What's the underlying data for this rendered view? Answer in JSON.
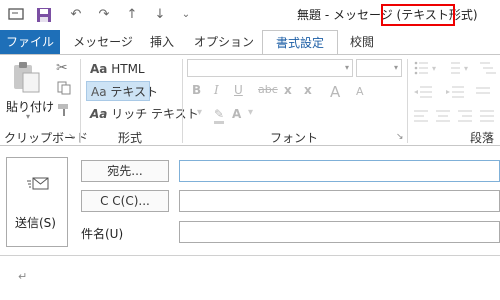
{
  "window": {
    "title": "無題 - メッセージ (テキスト形式)"
  },
  "qat": {
    "icons": [
      "minimize-box-icon",
      "save-icon",
      "undo-icon",
      "redo-icon",
      "up-arrow-icon",
      "down-arrow-icon",
      "customize-qat-icon"
    ]
  },
  "tabs": [
    {
      "label": "ファイル"
    },
    {
      "label": "メッセージ"
    },
    {
      "label": "挿入"
    },
    {
      "label": "オプション"
    },
    {
      "label": "書式設定"
    },
    {
      "label": "校閲"
    }
  ],
  "ribbon": {
    "clipboard": {
      "paste_label": "貼り付け",
      "group_label": "クリップボード"
    },
    "format": {
      "html_label": "HTML",
      "text_label": "テキスト",
      "richtext_label": "リッチ テキスト",
      "aa": "Aa",
      "group_label": "形式"
    },
    "font": {
      "group_label": "フォント",
      "bold": "B",
      "italic": "I",
      "underline": "U",
      "strike": "abc",
      "subscript": "x",
      "superscript": "x",
      "font_color": "A",
      "grow": "A",
      "shrink": "A"
    },
    "paragraph": {
      "group_label": "段落"
    }
  },
  "compose": {
    "send_label": "送信(S)",
    "to_label": "宛先...",
    "cc_label": "C C(C)...",
    "subject_label": "件名(U)",
    "body_mark": "↵"
  },
  "colors": {
    "file_tab": "#1e6fb8",
    "active_tab_text": "#1e5fa6",
    "highlight": "#e00000",
    "selected_format": "#cde3f5"
  }
}
